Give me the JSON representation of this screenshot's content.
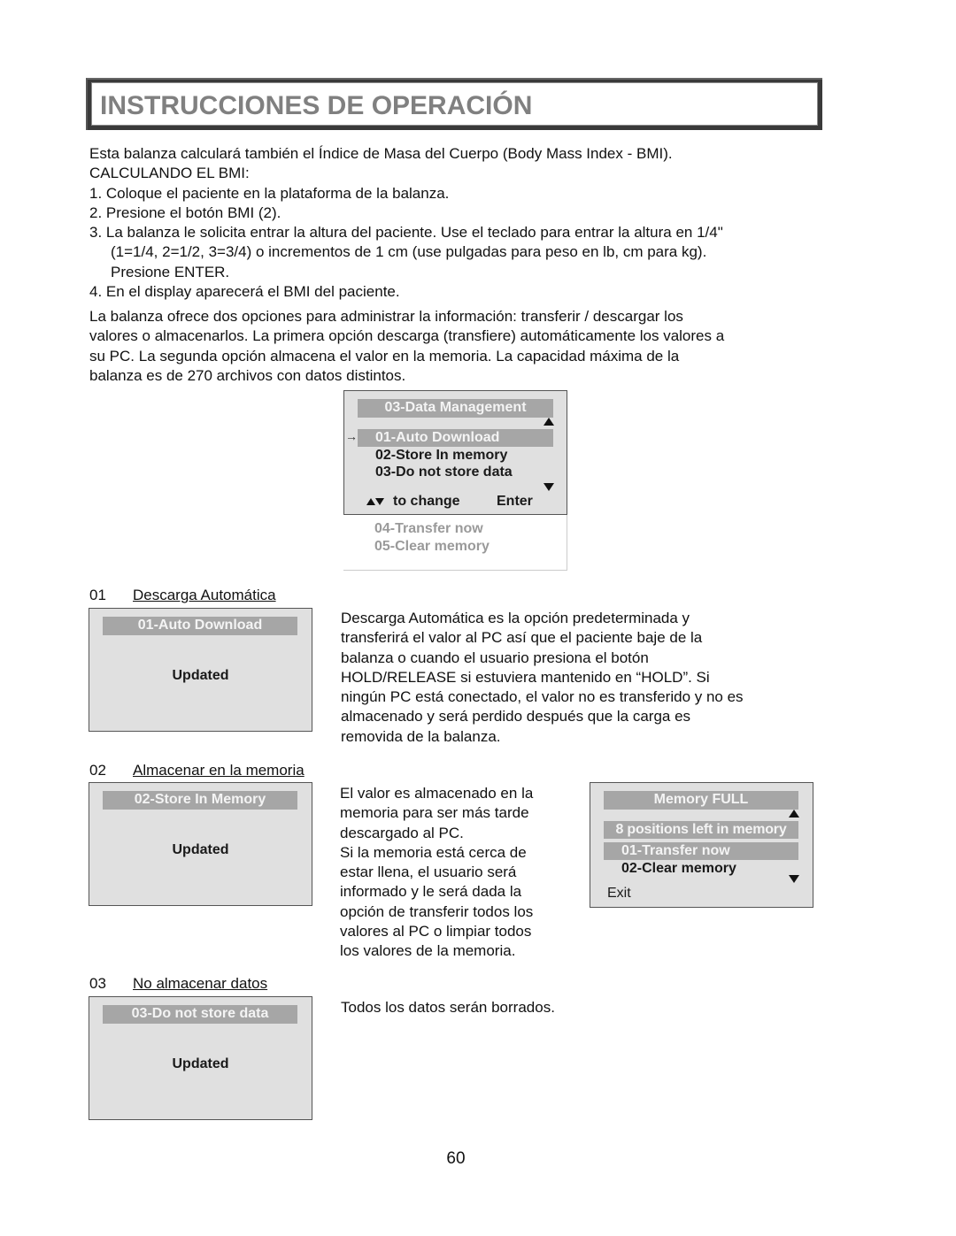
{
  "page": {
    "title": "INSTRUCCIONES DE OPERACIÓN",
    "page_number": "60"
  },
  "intro": {
    "lines": [
      "Esta balanza calculará también el Índice de Masa del Cuerpo (Body Mass Index - BMI).",
      "CALCULANDO EL BMI:",
      "1. Coloque el paciente en la plataforma de la balanza.",
      "2. Presione el botón BMI (2).",
      "3. La balanza le solicita entrar la altura del paciente. Use el teclado para entrar la altura en 1/4\"",
      "(1=1/4, 2=1/2, 3=3/4) o incrementos de 1 cm (use pulgadas para peso en lb, cm para kg).",
      "Presione ENTER.",
      "4. En el display aparecerá el BMI del paciente."
    ]
  },
  "options_paragraph": {
    "lines": [
      "La balanza ofrece dos opciones para administrar la información: transferir / descargar los",
      "valores o almacenarlos. La primera opción descarga (transfiere) automáticamente los valores a",
      "su PC. La segunda opción almacena el valor en la memoria. La capacidad máxima de la",
      "balanza es de 270 archivos con datos distintos."
    ]
  },
  "data_menu": {
    "header": "03-Data Management",
    "pointer_icon": "right-arrow",
    "items": [
      {
        "label": "01-Auto Download",
        "selected": true
      },
      {
        "label": "02-Store In memory",
        "selected": false
      },
      {
        "label": "03-Do not store data",
        "selected": false
      }
    ],
    "footer_change": "to change",
    "footer_enter": "Enter",
    "hidden_items": [
      "04-Transfer now",
      "05-Clear memory"
    ]
  },
  "sections": [
    {
      "number": "01",
      "title": "Descarga Automática",
      "lcd_header": "01-Auto Download",
      "lcd_status": "Updated",
      "description": [
        "Descarga Automática es la opción predeterminada y",
        "transferirá el valor al PC así que el paciente baje de la",
        "balanza o cuando el usuario presiona el botón",
        "HOLD/RELEASE si estuviera mantenido en “HOLD”. Si",
        "ningún PC está conectado, el valor no es transferido y no es",
        "almacenado y será perdido después que la carga es",
        "removida de la balanza."
      ]
    },
    {
      "number": "02",
      "title": "Almacenar en la memoria",
      "lcd_header": "02-Store In Memory",
      "lcd_status": "Updated",
      "description": [
        "El valor es almacenado en la",
        "memoria para ser más tarde",
        "descargado al PC.",
        "Si la memoria está cerca de",
        "estar llena, el usuario será",
        "informado y le será dada la",
        "opción de transferir todos los",
        "valores al PC o limpiar todos",
        "los valores de la memoria."
      ]
    },
    {
      "number": "03",
      "title": "No almacenar datos",
      "lcd_header": "03-Do not store data",
      "lcd_status": "Updated",
      "description": [
        "Todos los datos serán borrados."
      ]
    }
  ],
  "memory_full": {
    "header": "Memory FULL",
    "positions_left": "8 positions left in memory",
    "items": [
      {
        "label": "01-Transfer now",
        "selected": true
      },
      {
        "label": "02-Clear memory",
        "selected": false
      }
    ],
    "exit": "Exit"
  }
}
